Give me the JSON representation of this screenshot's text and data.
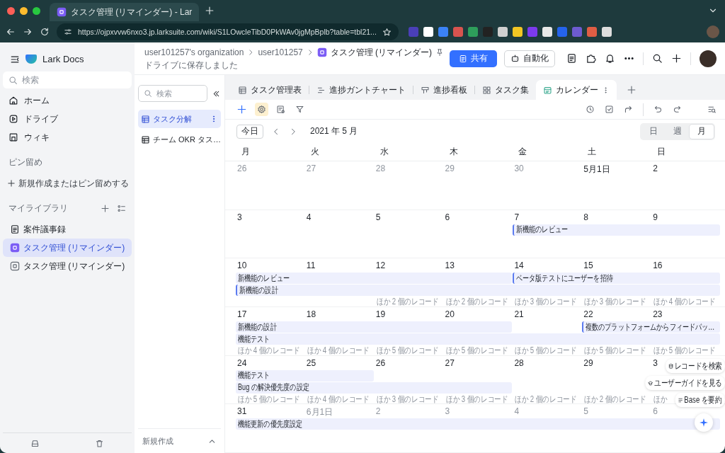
{
  "browser": {
    "tab_title": "タスク管理 (リマインダー) - Lar",
    "url": "https://ojpxvvw6nxo3.jp.larksuite.com/wiki/S1LOwcleTibD0PkWAv0jgMpBplb?table=tbl21..."
  },
  "sidebar": {
    "app_name": "Lark Docs",
    "search_placeholder": "検索",
    "nav": [
      {
        "label": "ホーム",
        "kind": "home"
      },
      {
        "label": "ドライブ",
        "kind": "drive"
      },
      {
        "label": "ウィキ",
        "kind": "wiki"
      }
    ],
    "pinned": {
      "heading": "ピン留め",
      "add_label": "新規作成またはピン留めする"
    },
    "library": {
      "heading": "マイライブラリ",
      "items": [
        {
          "label": "案件議事録",
          "kind": "doc",
          "selected": false
        },
        {
          "label": "タスク管理 (リマインダー)",
          "kind": "base",
          "selected": true
        },
        {
          "label": "タスク管理 (リマインダー)",
          "kind": "base",
          "selected": false
        }
      ]
    }
  },
  "header": {
    "breadcrumb": [
      "user101257's organization",
      "user101257"
    ],
    "doc_title": "タスク管理 (リマインダー)",
    "status": "ドライブに保存しました",
    "share_label": "共有",
    "automation_label": "自動化"
  },
  "table_panel": {
    "search_placeholder": "検索",
    "tables": [
      {
        "label": "タスク分解",
        "selected": true
      },
      {
        "label": "チーム OKR タス…",
        "selected": false
      }
    ],
    "new_label": "新規作成"
  },
  "views": [
    {
      "label": "タスク管理表",
      "kind": "grid",
      "selected": false
    },
    {
      "label": "進捗ガントチャート",
      "kind": "gantt",
      "selected": false
    },
    {
      "label": "進捗看板",
      "kind": "kanban",
      "selected": false
    },
    {
      "label": "タスク集",
      "kind": "gallery",
      "selected": false
    },
    {
      "label": "カレンダー",
      "kind": "calendar",
      "selected": true
    }
  ],
  "calendar": {
    "today_label": "今日",
    "month_title": "2021 年 5 月",
    "modes": [
      {
        "label": "日",
        "selected": false
      },
      {
        "label": "週",
        "selected": false
      },
      {
        "label": "月",
        "selected": true
      }
    ],
    "weekdays": [
      "月",
      "火",
      "水",
      "木",
      "金",
      "土",
      "日"
    ],
    "weeks": [
      {
        "days": [
          {
            "label": "26",
            "in_month": false
          },
          {
            "label": "27",
            "in_month": false
          },
          {
            "label": "28",
            "in_month": false
          },
          {
            "label": "29",
            "in_month": false
          },
          {
            "label": "30",
            "in_month": false
          },
          {
            "label": "5月1日",
            "in_month": true
          },
          {
            "label": "2",
            "in_month": true
          }
        ]
      },
      {
        "days": [
          {
            "label": "3",
            "in_month": true
          },
          {
            "label": "4",
            "in_month": true
          },
          {
            "label": "5",
            "in_month": true
          },
          {
            "label": "6",
            "in_month": true
          },
          {
            "label": "7",
            "in_month": true,
            "slots": [
              {
                "kind": "event",
                "title": "新機能のレビュー",
                "accent": true
              }
            ]
          },
          {
            "label": "8",
            "in_month": true,
            "slots": [
              {
                "kind": "continued"
              }
            ]
          },
          {
            "label": "9",
            "in_month": true,
            "slots": [
              {
                "kind": "continued"
              }
            ]
          }
        ]
      },
      {
        "days": [
          {
            "label": "10",
            "in_month": true,
            "slots": [
              {
                "kind": "event",
                "title": "新機能のレビュー",
                "accent": false
              },
              {
                "kind": "event",
                "title": "新機能の設計",
                "accent": true
              }
            ]
          },
          {
            "label": "11",
            "in_month": true,
            "slots": [
              {
                "kind": "continued"
              },
              {
                "kind": "continued"
              }
            ]
          },
          {
            "label": "12",
            "in_month": true,
            "more": "ほか 2 個のレコード",
            "slots": [
              {
                "kind": "continued"
              },
              {
                "kind": "continued"
              }
            ]
          },
          {
            "label": "13",
            "in_month": true,
            "more": "ほか 2 個のレコード",
            "slots": [
              {
                "kind": "continued"
              },
              {
                "kind": "continued"
              }
            ]
          },
          {
            "label": "14",
            "in_month": true,
            "more": "ほか 3 個のレコード",
            "slots": [
              {
                "kind": "event",
                "title": "ベータ版テストにユーザーを招待",
                "accent": true
              },
              {
                "kind": "continued"
              }
            ]
          },
          {
            "label": "15",
            "in_month": true,
            "more": "ほか 3 個のレコード",
            "slots": [
              {
                "kind": "continued"
              },
              {
                "kind": "continued"
              }
            ]
          },
          {
            "label": "16",
            "in_month": true,
            "more": "ほか 4 個のレコード",
            "slots": [
              {
                "kind": "continued"
              },
              {
                "kind": "continued"
              }
            ]
          }
        ]
      },
      {
        "days": [
          {
            "label": "17",
            "in_month": true,
            "more": "ほか 4 個のレコード",
            "slots": [
              {
                "kind": "event",
                "title": "新機能の設計",
                "accent": false
              },
              {
                "kind": "event",
                "title": "機能テスト",
                "accent": false
              }
            ]
          },
          {
            "label": "18",
            "in_month": true,
            "more": "ほか 4 個のレコード",
            "slots": [
              {
                "kind": "continued"
              },
              {
                "kind": "continued"
              }
            ]
          },
          {
            "label": "19",
            "in_month": true,
            "more": "ほか 5 個のレコード",
            "slots": [
              {
                "kind": "continued"
              },
              {
                "kind": "continued"
              }
            ]
          },
          {
            "label": "20",
            "in_month": true,
            "more": "ほか 5 個のレコード",
            "slots": [
              {
                "kind": "continued"
              },
              {
                "kind": "continued"
              }
            ]
          },
          {
            "label": "21",
            "in_month": true,
            "more": "ほか 5 個のレコード",
            "slots": [
              {
                "kind": "empty"
              },
              {
                "kind": "continued"
              }
            ]
          },
          {
            "label": "22",
            "in_month": true,
            "more": "ほか 5 個のレコード",
            "slots": [
              {
                "kind": "event",
                "title": "複数のプラットフォームからフィードバッ…",
                "accent": true
              },
              {
                "kind": "continued"
              }
            ]
          },
          {
            "label": "23",
            "in_month": true,
            "more": "ほか 5 個のレコード",
            "slots": [
              {
                "kind": "continued"
              },
              {
                "kind": "continued"
              }
            ]
          }
        ]
      },
      {
        "days": [
          {
            "label": "24",
            "in_month": true,
            "more": "ほか 5 個のレコード",
            "slots": [
              {
                "kind": "event",
                "title": "機能テスト",
                "accent": false
              },
              {
                "kind": "event",
                "title": "Bug の解決優先度の設定",
                "accent": false
              }
            ]
          },
          {
            "label": "25",
            "in_month": true,
            "more": "ほか 4 個のレコード",
            "slots": [
              {
                "kind": "continued"
              },
              {
                "kind": "continued"
              }
            ]
          },
          {
            "label": "26",
            "in_month": true,
            "more": "ほか 3 個のレコード",
            "slots": [
              {
                "kind": "empty"
              },
              {
                "kind": "continued"
              }
            ]
          },
          {
            "label": "27",
            "in_month": true,
            "more": "ほか 3 個のレコード",
            "slots": [
              {
                "kind": "empty"
              },
              {
                "kind": "continued"
              }
            ]
          },
          {
            "label": "28",
            "in_month": true,
            "more": "ほか 2 個のレコード"
          },
          {
            "label": "29",
            "in_month": true,
            "more": "ほか 2 個のレコード"
          },
          {
            "label": "3",
            "in_month": true,
            "more": "ほか"
          }
        ]
      },
      {
        "days": [
          {
            "label": "31",
            "in_month": true,
            "slots": [
              {
                "kind": "event",
                "title": "機能更新の優先度設定",
                "accent": false
              }
            ]
          },
          {
            "label": "6月1日",
            "in_month": false,
            "slots": [
              {
                "kind": "continued"
              }
            ]
          },
          {
            "label": "2",
            "in_month": false,
            "slots": [
              {
                "kind": "continued"
              }
            ]
          },
          {
            "label": "3",
            "in_month": false,
            "slots": [
              {
                "kind": "continued"
              }
            ]
          },
          {
            "label": "4",
            "in_month": false,
            "slots": [
              {
                "kind": "continued"
              }
            ]
          },
          {
            "label": "5",
            "in_month": false,
            "slots": [
              {
                "kind": "continued"
              }
            ]
          },
          {
            "label": "6",
            "in_month": false,
            "slots": [
              {
                "kind": "continued"
              }
            ]
          }
        ]
      }
    ]
  },
  "assistant": {
    "actions": [
      {
        "label": "レコードを検索",
        "kind": "search"
      },
      {
        "label": "ユーザーガイドを見る",
        "kind": "guide"
      },
      {
        "label": "Base を要約",
        "kind": "summary"
      }
    ]
  }
}
